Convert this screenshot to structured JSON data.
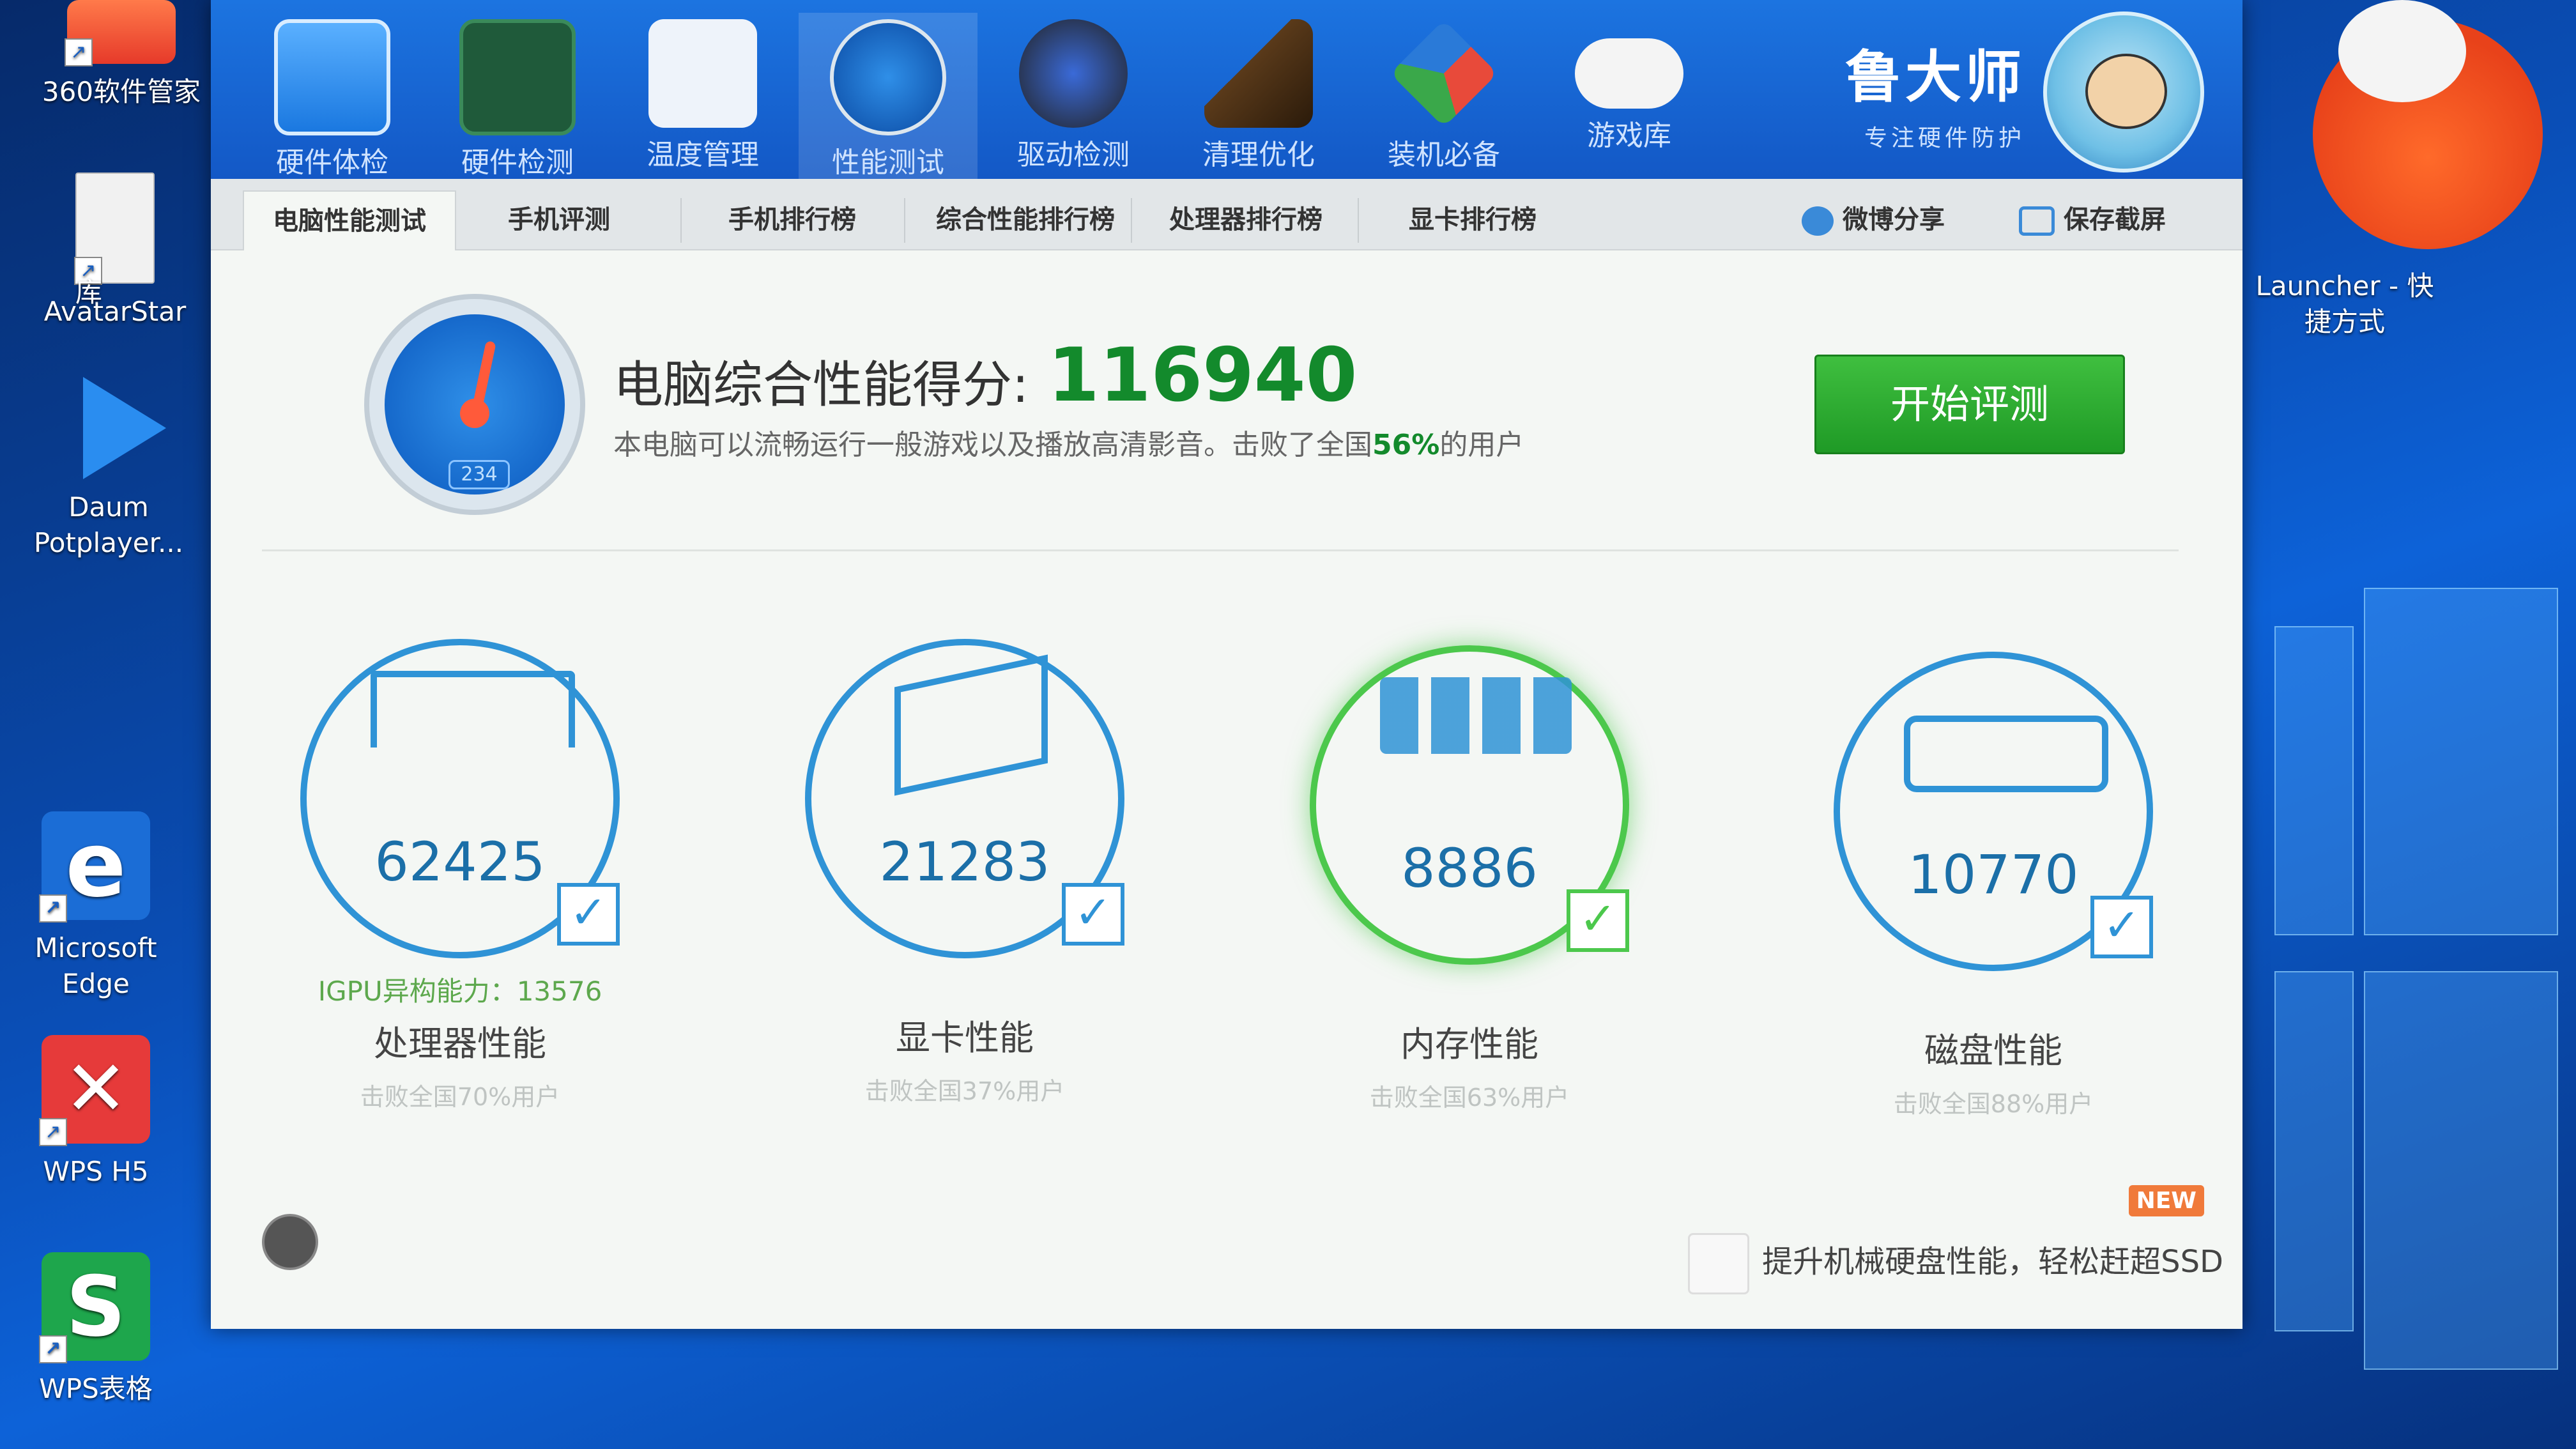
{
  "desktop": {
    "icons": [
      {
        "label": "360软件管家"
      },
      {
        "label": "AvatarStar"
      },
      {
        "label": "Daum Potplayer..."
      },
      {
        "label": "Microsoft Edge"
      },
      {
        "label": "WPS H5"
      },
      {
        "label": "WPS表格"
      },
      {
        "label": "Launcher - 快捷方式"
      }
    ],
    "partial_left_label": "库"
  },
  "toolbar": {
    "items": [
      {
        "label": "硬件体检",
        "icon": "monitor-icon"
      },
      {
        "label": "硬件检测",
        "icon": "board-icon"
      },
      {
        "label": "温度管理",
        "icon": "thermometer-icon"
      },
      {
        "label": "性能测试",
        "icon": "speedometer-icon"
      },
      {
        "label": "驱动检测",
        "icon": "driver-gear-icon"
      },
      {
        "label": "清理优化",
        "icon": "broom-icon"
      },
      {
        "label": "装机必备",
        "icon": "cube-icon"
      },
      {
        "label": "游戏库",
        "icon": "gamepad-icon"
      }
    ],
    "active_index": 3
  },
  "brand": {
    "name": "鲁大师",
    "slogan": "专注硬件防护"
  },
  "tabs": {
    "items": [
      "电脑性能测试",
      "手机评测",
      "手机排行榜",
      "综合性能排行榜",
      "处理器排行榜",
      "显卡排行榜"
    ],
    "share": "微博分享",
    "screenshot": "保存截屏"
  },
  "score": {
    "label": "电脑综合性能得分:",
    "value": "116940",
    "desc_prefix": "本电脑可以流畅运行一般游戏以及播放高清影音。击败了全国",
    "desc_percent": "56%",
    "desc_suffix": "的用户",
    "gauge_digits": "234",
    "start_button": "开始评测"
  },
  "metrics": [
    {
      "value": "62425",
      "name": "处理器性能",
      "sub": "击败全国70%用户",
      "extra": "IGPU异构能力：13576",
      "icon": "cpu-monitor-icon"
    },
    {
      "value": "21283",
      "name": "显卡性能",
      "sub": "击败全国37%用户",
      "icon": "gpu-cube-icon"
    },
    {
      "value": "8886",
      "name": "内存性能",
      "sub": "击败全国63%用户",
      "icon": "memory-chip-icon"
    },
    {
      "value": "10770",
      "name": "磁盘性能",
      "sub": "击败全国88%用户",
      "icon": "disk-drive-icon"
    }
  ],
  "promo": {
    "badge": "NEW",
    "text": "提升机械硬盘性能，轻松赶超SSD"
  },
  "colors": {
    "accent_blue": "#1358c6",
    "score_green": "#138a2c",
    "ring_blue": "#2f93d6",
    "ring_green": "#4cc84c"
  }
}
